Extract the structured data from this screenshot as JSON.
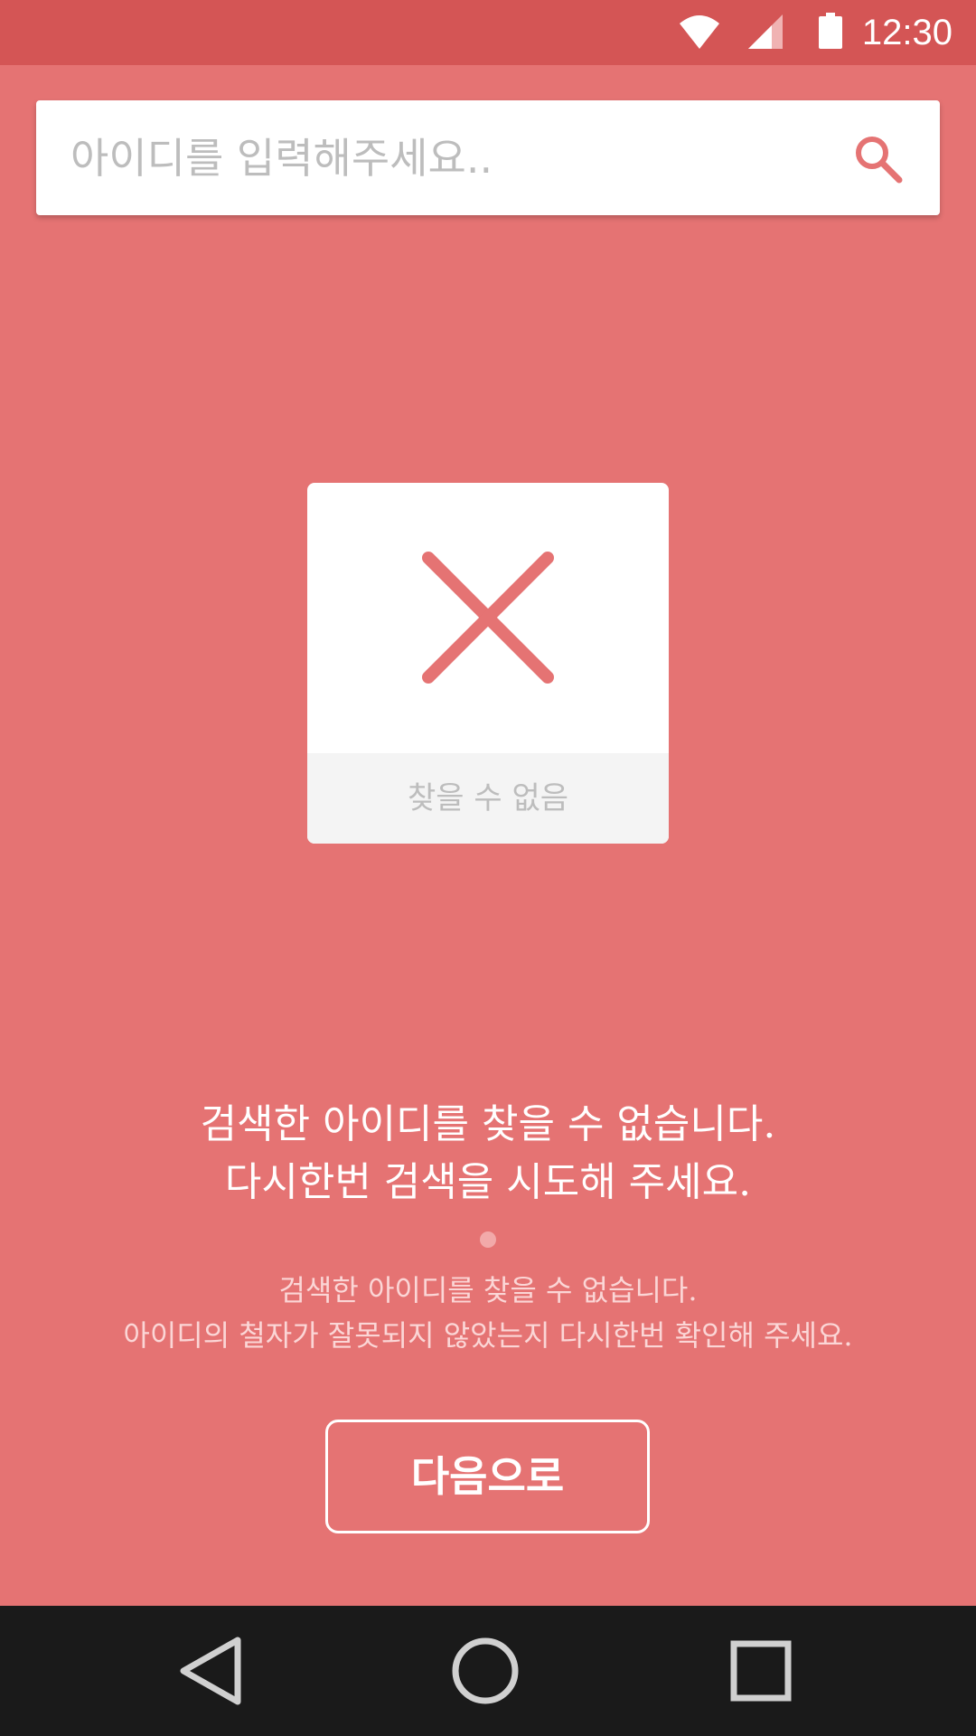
{
  "status_bar": {
    "time": "12:30",
    "icons": [
      "wifi-icon",
      "cellular-signal-icon",
      "battery-icon"
    ]
  },
  "search": {
    "placeholder": "아이디를 입력해주세요..",
    "value": "",
    "icon": "search-icon"
  },
  "result_card": {
    "icon": "x-icon",
    "label": "찾을 수 없음"
  },
  "message": {
    "headline_line1": "검색한 아이디를 찾을 수 없습니다.",
    "headline_line2": "다시한번 검색을 시도해 주세요.",
    "detail_line1": "검색한 아이디를 찾을 수 없습니다.",
    "detail_line2": "아이디의 철자가 잘못되지 않았는지 다시한번 확인해 주세요."
  },
  "next_button": {
    "label": "다음으로"
  },
  "nav_bar": {
    "icons": [
      "back-icon",
      "home-icon",
      "recents-icon"
    ]
  },
  "colors": {
    "background": "#e57373",
    "status_bar": "#d45555",
    "accent": "#e57373",
    "nav_bar": "#1a1a1a"
  }
}
